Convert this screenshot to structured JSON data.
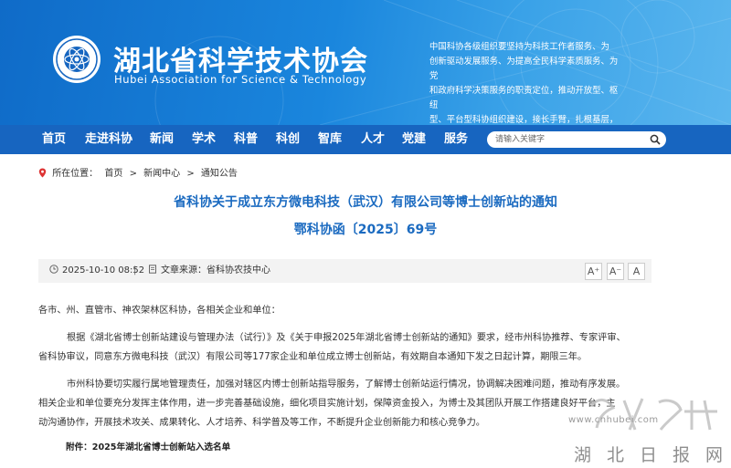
{
  "header": {
    "title": "湖北省科学技术协会",
    "subtitle": "Hubei Association for Science & Technology",
    "mission_lines": [
      "中国科协各级组织要坚持为科技工作者服务、为",
      "创新驱动发展服务、为提高全民科学素质服务、为党",
      "和政府科学决策服务的职责定位，推动开放型、枢纽",
      "型、平台型科协组织建设，接长手臂，扎根基层，团"
    ]
  },
  "nav": {
    "items": [
      "首页",
      "走进科协",
      "新闻",
      "学术",
      "科普",
      "科创",
      "智库",
      "人才",
      "党建",
      "服务"
    ],
    "search_placeholder": "请输入关键字"
  },
  "breadcrumb": {
    "label": "所在位置：",
    "items": [
      "首页",
      ">",
      "新闻中心",
      ">",
      "通知公告"
    ]
  },
  "article": {
    "title": "省科协关于成立东方微电科技（武汉）有限公司等博士创新站的通知",
    "doc_number": "鄂科协函〔2025〕69号",
    "date": "2025-10-10 08:52",
    "separator": "|",
    "source": "文章来源：省科协农技中心",
    "font_buttons": [
      "A⁺",
      "A⁻",
      "A"
    ],
    "greeting": "各市、州、直管市、神农架林区科协，各相关企业和单位：",
    "para1_line1": "根据《湖北省博士创新站建设与管理办法（试行）》及《关于申报2025年湖北省博士创新站的通知》要求，经市州科协推荐、专家评审、",
    "para1_line2": "省科协审议，同意东方微电科技（武汉）有限公司等177家企业和单位成立博士创新站，有效期自本通知下发之日起计算，期限三年。",
    "para2_line1": "市州科协要切实履行属地管理责任，加强对辖区内博士创新站指导服务，了解博士创新站运行情况，协调解决困难问题，推动有序发展。",
    "para2_line2": "相关企业和单位要充分发挥主体作用，进一步完善基础设施，细化项目实施计划，保障资金投入，为博士及其团队开展工作搭建良好平台，主",
    "para2_line3": "动沟通协作，开展技术攻关、成果转化、人才培养、科学普及等工作，不断提升企业创新能力和核心竞争力。",
    "attachment": "附件：2025年湖北省博士创新站入选名单"
  },
  "watermark": {
    "url": "www.cnhubei.com",
    "name": "湖北日报网"
  },
  "colors": {
    "nav_bg": "#1765c0",
    "title_blue": "#1a6ac0"
  }
}
